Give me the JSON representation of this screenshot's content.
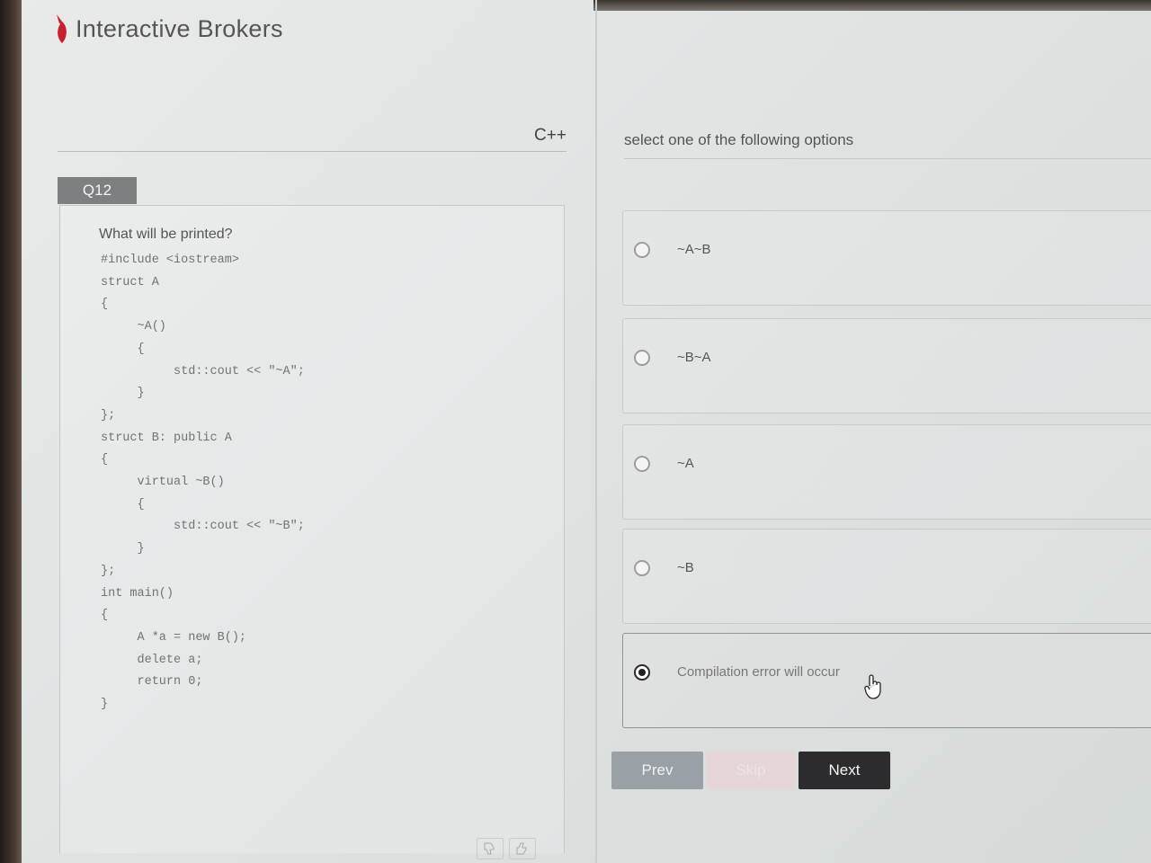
{
  "brand": {
    "name": "Interactive Brokers"
  },
  "header": {
    "language": "C++",
    "instruction": "select one of the following options"
  },
  "question": {
    "number": "Q12",
    "prompt": "What will be printed?",
    "code_lines": [
      "#include <iostream>",
      "",
      "",
      "struct A",
      "{",
      "     ~A()",
      "     {",
      "          std::cout << \"~A\";",
      "     }",
      "};",
      "",
      "struct B: public A",
      "{",
      "     virtual ~B()",
      "     {",
      "          std::cout << \"~B\";",
      "     }",
      "};",
      "",
      "",
      "int main()",
      "{",
      "     A *a = new B();",
      "     delete a;",
      "     return 0;",
      "}"
    ]
  },
  "options": [
    {
      "label": "~A~B",
      "selected": false
    },
    {
      "label": "~B~A",
      "selected": false
    },
    {
      "label": "~A",
      "selected": false
    },
    {
      "label": "~B",
      "selected": false
    },
    {
      "label": "Compilation error will occur",
      "selected": true
    }
  ],
  "buttons": {
    "prev": "Prev",
    "skip": "Skip",
    "next": "Next"
  },
  "colors": {
    "brand_red": "#c8202e",
    "next_button": "#2c2c2e",
    "prev_button": "#9aa1a6",
    "question_tab": "#7d7f80"
  }
}
